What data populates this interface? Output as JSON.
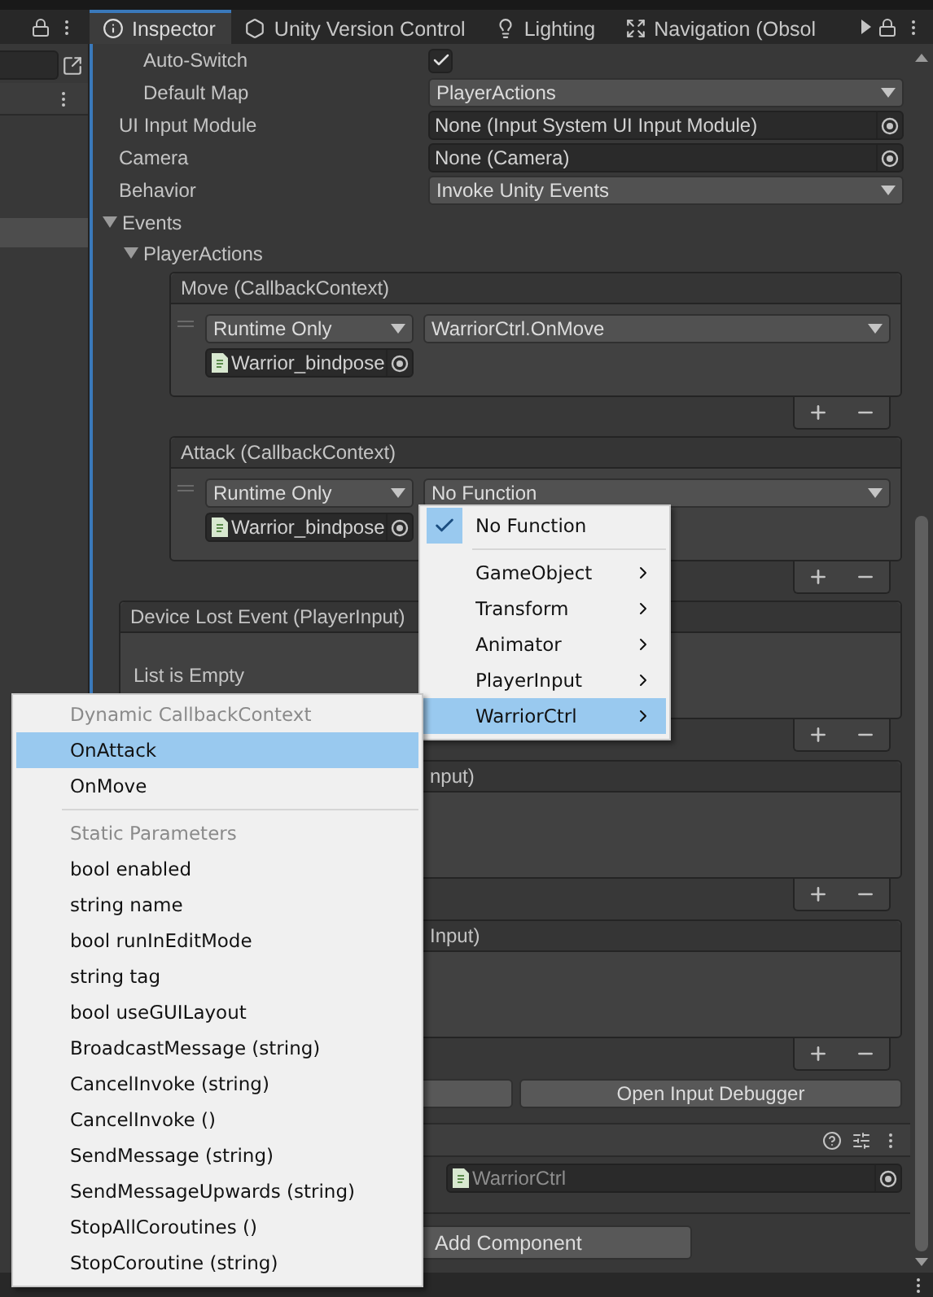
{
  "tabs": [
    {
      "label": "Inspector",
      "selected": true
    },
    {
      "label": "Unity Version Control",
      "selected": false
    },
    {
      "label": "Lighting",
      "selected": false
    },
    {
      "label": "Navigation (Obsol",
      "selected": false
    }
  ],
  "sub_properties": [
    {
      "kind": "checkbox",
      "label": "Auto-Switch",
      "checked": true
    },
    {
      "kind": "dropdown",
      "label": "Default Map",
      "value": "PlayerActions"
    }
  ],
  "properties": [
    {
      "kind": "object",
      "label": "UI Input Module",
      "value": "None (Input System UI Input Module)"
    },
    {
      "kind": "object",
      "label": "Camera",
      "value": "None (Camera)"
    },
    {
      "kind": "dropdown",
      "label": "Behavior",
      "value": "Invoke Unity Events"
    }
  ],
  "events": {
    "label": "Events",
    "expanded": true,
    "children": [
      {
        "label": "PlayerActions",
        "expanded": true,
        "callbacks": [
          {
            "header": "Move (CallbackContext)",
            "listeners": [
              {
                "mode": "Runtime Only",
                "function": "WarriorCtrl.OnMove",
                "target": "Warrior_bindpose"
              }
            ]
          },
          {
            "header": "Attack (CallbackContext)",
            "listeners": [
              {
                "mode": "Runtime Only",
                "function": "No Function",
                "target": "Warrior_bindpose"
              }
            ]
          }
        ]
      }
    ]
  },
  "other_events": [
    {
      "header": "Device Lost Event (PlayerInput)",
      "empty_text": "List is Empty"
    },
    {
      "header": "nput)"
    },
    {
      "header": "Input)"
    }
  ],
  "debug_button": "Open Input Debugger",
  "component": {
    "script": "WarriorCtrl"
  },
  "add_component": "Add Component",
  "function_menu": [
    {
      "kind": "item",
      "label": "No Function",
      "checked": true,
      "selected": false
    },
    {
      "kind": "separator"
    },
    {
      "kind": "submenu",
      "label": "GameObject",
      "selected": false
    },
    {
      "kind": "submenu",
      "label": "Transform",
      "selected": false
    },
    {
      "kind": "submenu",
      "label": "Animator",
      "selected": false
    },
    {
      "kind": "submenu",
      "label": "PlayerInput",
      "selected": false
    },
    {
      "kind": "submenu",
      "label": "WarriorCtrl",
      "selected": true
    }
  ],
  "method_menu": [
    {
      "kind": "header",
      "label": "Dynamic CallbackContext"
    },
    {
      "kind": "item",
      "label": "OnAttack",
      "selected": true
    },
    {
      "kind": "item",
      "label": "OnMove",
      "selected": false
    },
    {
      "kind": "separator"
    },
    {
      "kind": "header",
      "label": "Static Parameters"
    },
    {
      "kind": "item",
      "label": "bool enabled",
      "selected": false
    },
    {
      "kind": "item",
      "label": "string name",
      "selected": false
    },
    {
      "kind": "item",
      "label": "bool runInEditMode",
      "selected": false
    },
    {
      "kind": "item",
      "label": "string tag",
      "selected": false
    },
    {
      "kind": "item",
      "label": "bool useGUILayout",
      "selected": false
    },
    {
      "kind": "item",
      "label": "BroadcastMessage (string)",
      "selected": false
    },
    {
      "kind": "item",
      "label": "CancelInvoke (string)",
      "selected": false
    },
    {
      "kind": "item",
      "label": "CancelInvoke ()",
      "selected": false
    },
    {
      "kind": "item",
      "label": "SendMessage (string)",
      "selected": false
    },
    {
      "kind": "item",
      "label": "SendMessageUpwards (string)",
      "selected": false
    },
    {
      "kind": "item",
      "label": "StopAllCoroutines ()",
      "selected": false
    },
    {
      "kind": "item",
      "label": "StopCoroutine (string)",
      "selected": false
    }
  ]
}
